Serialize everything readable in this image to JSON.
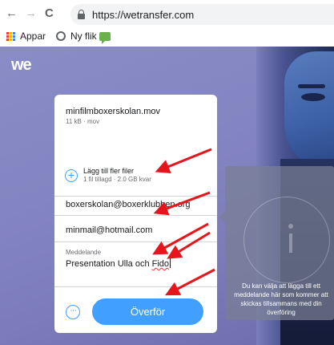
{
  "browser": {
    "nav": {
      "back": "←",
      "forward": "→",
      "reload": "C"
    },
    "url": "https://wetransfer.com",
    "bookmarks": [
      {
        "label": "Appar",
        "icon": "apps-grid-icon"
      },
      {
        "label": "Ny flik",
        "icon": "globe-icon"
      },
      {
        "label": "",
        "icon": "green-chat-icon"
      }
    ]
  },
  "site": {
    "logo": "we"
  },
  "panel": {
    "file_name": "minfilmboxerskolan.mov",
    "file_meta": "11 kB · mov",
    "add_files_title": "Lägg till fler filer",
    "add_files_sub": "1 fil tillagd · 2.0 GB kvar",
    "recipient_email": "boxerskolan@boxerklubben.org",
    "sender_email": "minmail@hotmail.com",
    "message_label": "Meddelande",
    "message_text_before": "Presentation Ulla och ",
    "message_text_misspelled": "Fido",
    "more_label": "···",
    "send_label": "Överför"
  },
  "tooltip": {
    "text": "Du kan välja att lägga till ett meddelande här som kommer att skickas tillsammans med din överföring"
  },
  "colors": {
    "accent": "#409fff",
    "annotation_arrow": "#e8141b",
    "background": "#8385c2"
  }
}
